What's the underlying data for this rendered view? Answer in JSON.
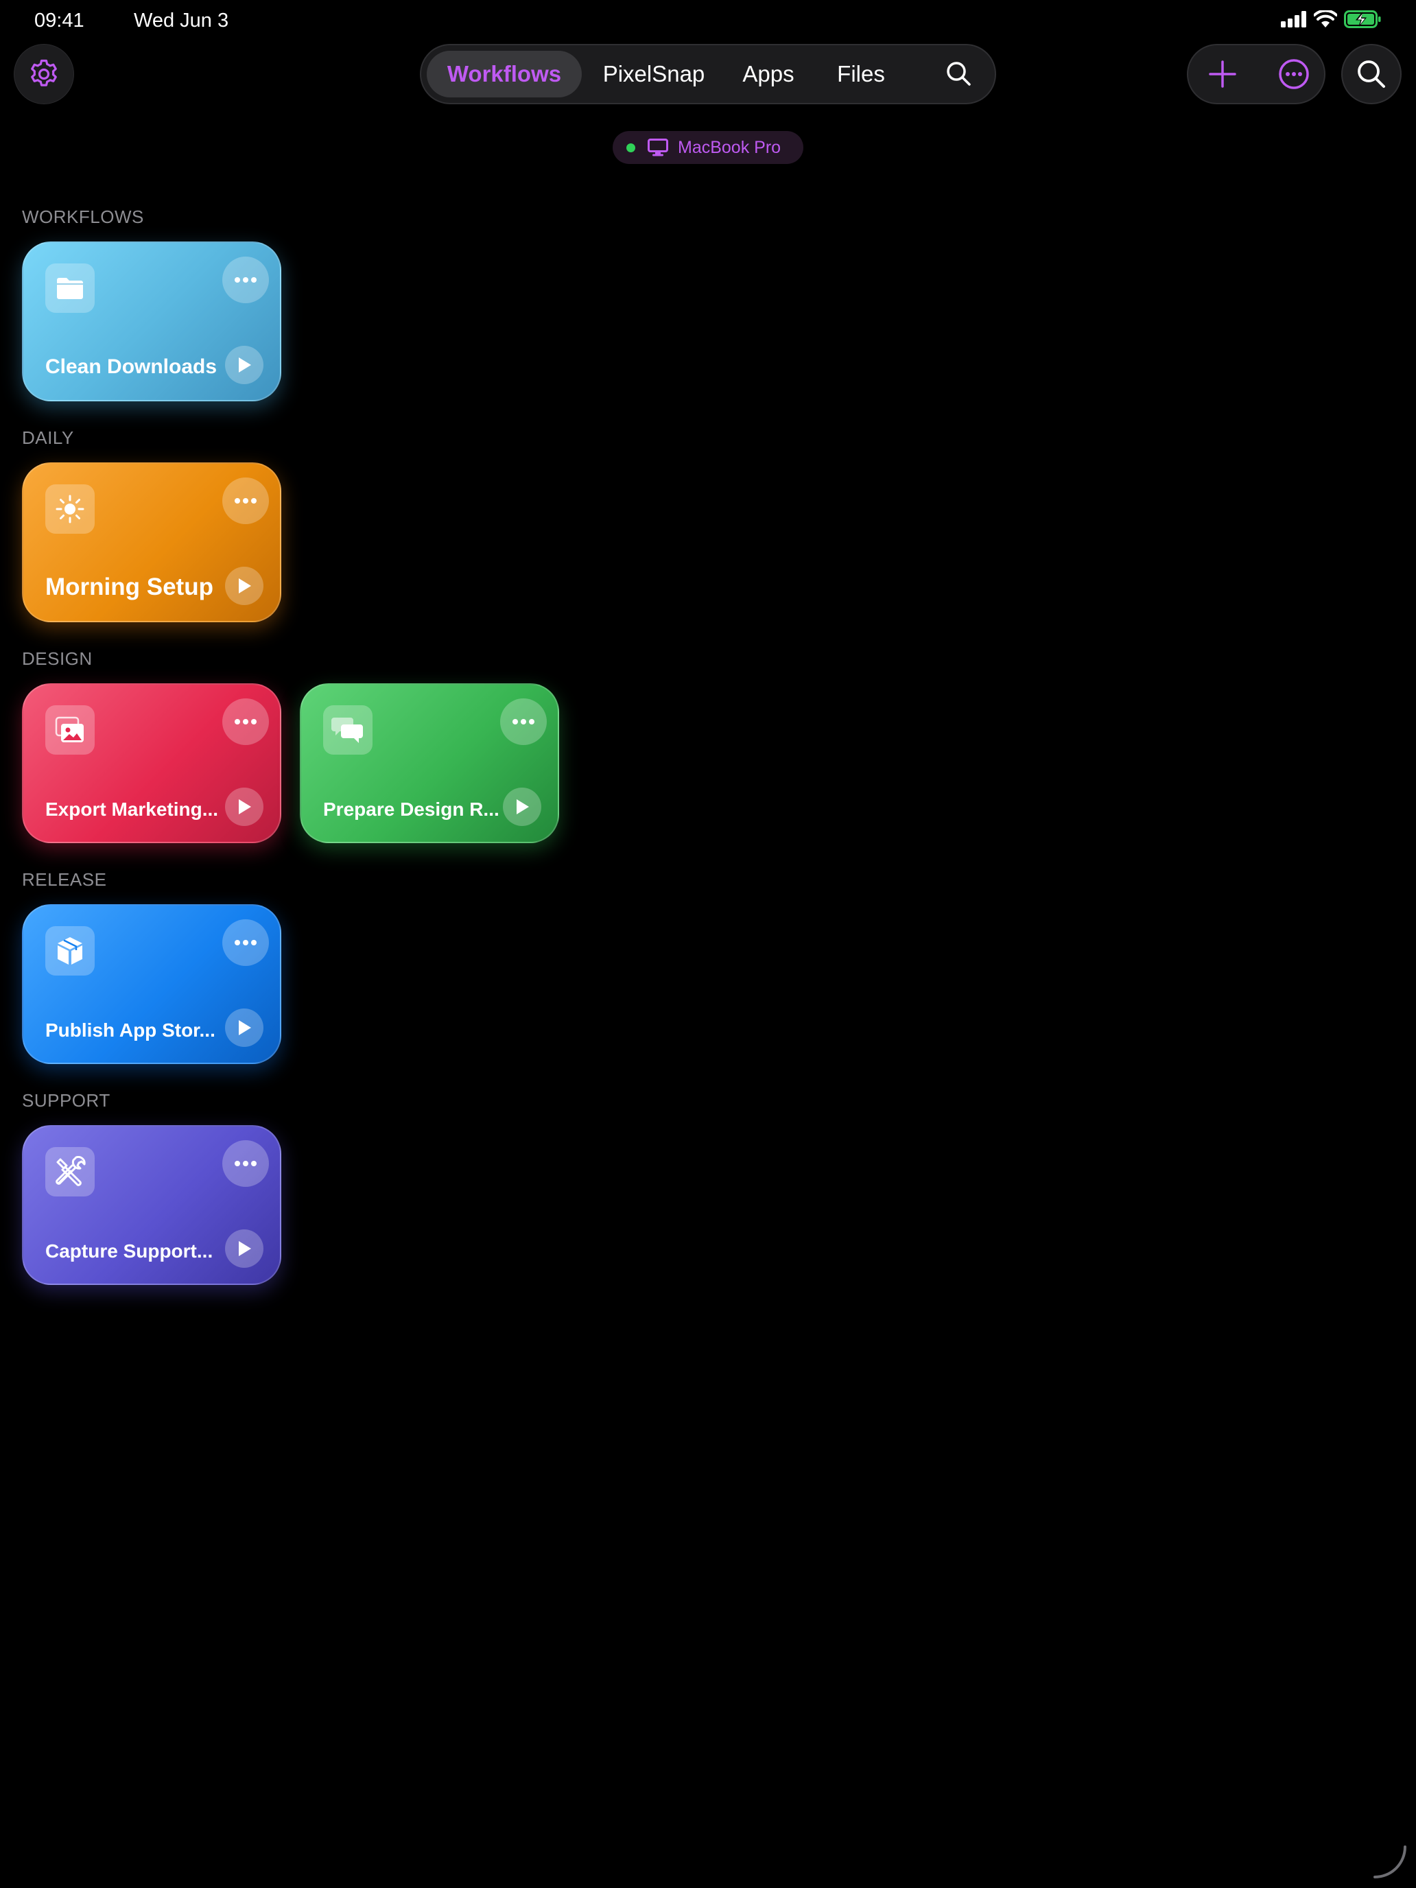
{
  "status": {
    "time": "09:41",
    "date": "Wed Jun 3"
  },
  "tabs": [
    {
      "label": "Workflows",
      "active": true
    },
    {
      "label": "PixelSnap",
      "active": false
    },
    {
      "label": "Apps",
      "active": false
    },
    {
      "label": "Files",
      "active": false
    }
  ],
  "device": {
    "name": "MacBook Pro",
    "online": true
  },
  "accent": "#bf5af2",
  "sections": [
    {
      "title": "WORKFLOWS",
      "cards": [
        {
          "title": "Clean Downloads",
          "icon": "folder-icon",
          "color": "#5ab8e0"
        }
      ]
    },
    {
      "title": "DAILY",
      "cards": [
        {
          "title": "Morning Setup",
          "icon": "sun-icon",
          "color": "#ea8c0c"
        }
      ]
    },
    {
      "title": "DESIGN",
      "cards": [
        {
          "title": "Export Marketing...",
          "icon": "photos-icon",
          "color": "#e5284e"
        },
        {
          "title": "Prepare Design R...",
          "icon": "chat-bubbles-icon",
          "color": "#38b552"
        }
      ]
    },
    {
      "title": "RELEASE",
      "cards": [
        {
          "title": "Publish App Stor...",
          "icon": "cube-icon",
          "color": "#1681f0"
        }
      ]
    },
    {
      "title": "SUPPORT",
      "cards": [
        {
          "title": "Capture Support...",
          "icon": "tools-icon",
          "color": "#5a52cf"
        }
      ]
    }
  ]
}
